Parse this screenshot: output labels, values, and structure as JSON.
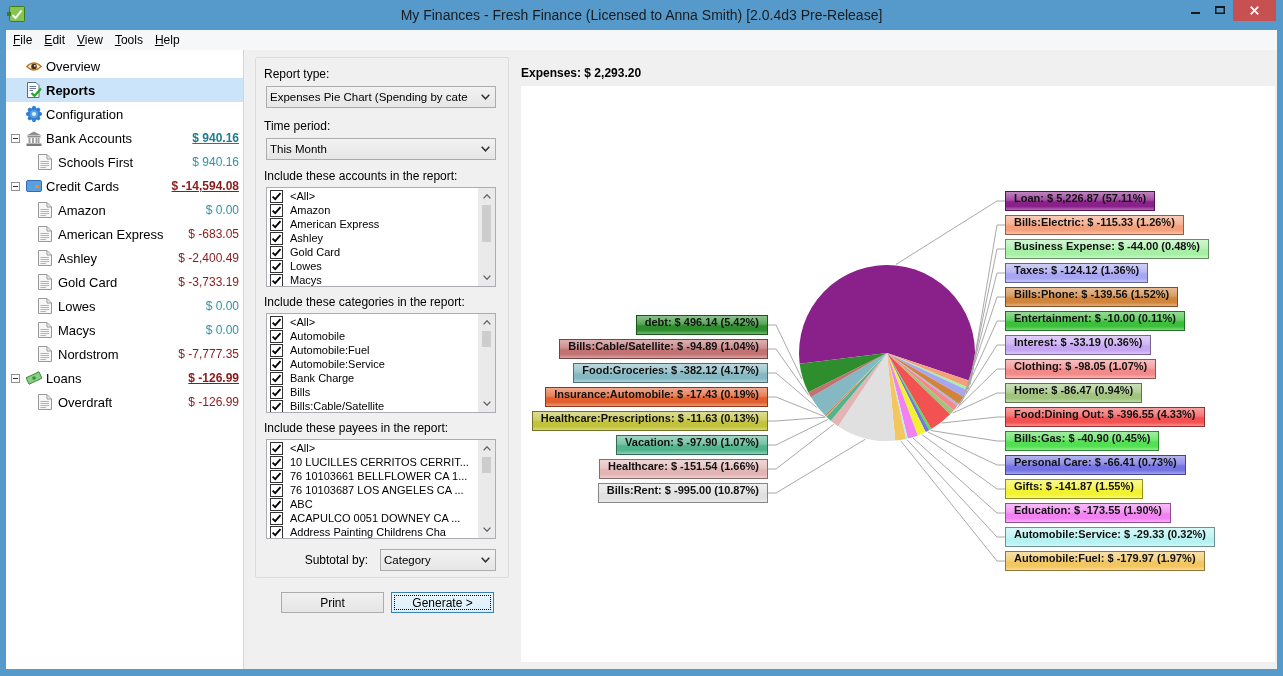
{
  "window": {
    "title": "My Finances - Fresh Finance (Licensed to Anna Smith) [2.0.4d3 Pre-Release]"
  },
  "menu": [
    "File",
    "Edit",
    "View",
    "Tools",
    "Help"
  ],
  "sidebar": {
    "items": [
      {
        "label": "Overview",
        "kind": "overview",
        "selected": false
      },
      {
        "label": "Reports",
        "kind": "reports",
        "selected": true
      },
      {
        "label": "Configuration",
        "kind": "configuration",
        "selected": false
      }
    ],
    "groups": [
      {
        "label": "Bank Accounts",
        "kind": "bank",
        "total": "$ 940.16",
        "negative": false,
        "expanded": true,
        "selected": false,
        "children": [
          {
            "label": "Schools First",
            "balance": "$ 940.16",
            "negative": false,
            "selected": false
          }
        ]
      },
      {
        "label": "Credit Cards",
        "kind": "card",
        "total": "$ -14,594.08",
        "negative": true,
        "expanded": true,
        "selected": false,
        "children": [
          {
            "label": "Amazon",
            "balance": "$ 0.00",
            "negative": false,
            "selected": false
          },
          {
            "label": "American Express",
            "balance": "$ -683.05",
            "negative": true,
            "selected": false
          },
          {
            "label": "Ashley",
            "balance": "$ -2,400.49",
            "negative": true,
            "selected": false
          },
          {
            "label": "Gold Card",
            "balance": "$ -3,733.19",
            "negative": true,
            "selected": false
          },
          {
            "label": "Lowes",
            "balance": "$ 0.00",
            "negative": false,
            "selected": false
          },
          {
            "label": "Macys",
            "balance": "$ 0.00",
            "negative": false,
            "selected": false
          },
          {
            "label": "Nordstrom",
            "balance": "$ -7,777.35",
            "negative": true,
            "selected": false
          }
        ]
      },
      {
        "label": "Loans",
        "kind": "loan",
        "total": "$ -126.99",
        "negative": true,
        "expanded": true,
        "selected": false,
        "children": [
          {
            "label": "Overdraft",
            "balance": "$ -126.99",
            "negative": true,
            "selected": false
          }
        ]
      }
    ]
  },
  "report_options": {
    "report_type": {
      "label": "Report type:",
      "value": "Expenses Pie Chart (Spending by cate"
    },
    "time_period": {
      "label": "Time period:",
      "value": "This Month"
    },
    "lists": [
      {
        "label": "Include these accounts in the report:",
        "items": [
          {
            "label": "<All>",
            "checked": true
          },
          {
            "label": "Amazon",
            "checked": true
          },
          {
            "label": "American Express",
            "checked": true
          },
          {
            "label": "Ashley",
            "checked": true
          },
          {
            "label": "Gold Card",
            "checked": true
          },
          {
            "label": "Lowes",
            "checked": true
          },
          {
            "label": "Macys",
            "checked": true
          }
        ]
      },
      {
        "label": "Include these categories in the report:",
        "items": [
          {
            "label": "<All>",
            "checked": true
          },
          {
            "label": "Automobile",
            "checked": true
          },
          {
            "label": "Automobile:Fuel",
            "checked": true
          },
          {
            "label": "Automobile:Service",
            "checked": true
          },
          {
            "label": "Bank Charge",
            "checked": true
          },
          {
            "label": "Bills",
            "checked": true
          },
          {
            "label": "Bills:Cable/Satellite",
            "checked": true
          }
        ]
      },
      {
        "label": "Include these payees in the report:",
        "items": [
          {
            "label": "<All>",
            "checked": true
          },
          {
            "label": "10 LUCILLES CERRITOS CERRIT...",
            "checked": true
          },
          {
            "label": "76 10103661 BELLFLOWER CA 1...",
            "checked": true
          },
          {
            "label": "76 10103687 LOS ANGELES CA ...",
            "checked": true
          },
          {
            "label": "ABC",
            "checked": true
          },
          {
            "label": "ACAPULCO 0051 DOWNEY CA ...",
            "checked": true
          },
          {
            "label": "Address Painting Childrens Cha",
            "checked": true
          }
        ]
      }
    ],
    "subtotal": {
      "label": "Subtotal by:",
      "value": "Category"
    },
    "buttons": [
      {
        "label": "Print",
        "focused": false
      },
      {
        "label": "Generate >",
        "focused": true
      }
    ]
  },
  "report": {
    "header": "Expenses: $ 2,293.20",
    "chart_data": {
      "type": "pie",
      "categories": [
        "Loan: $ 5,226.87 (57.11%)",
        "Bills:Electric: $ -115.33 (1.26%)",
        "Business Expense: $ -44.00 (0.48%)",
        "Taxes: $ -124.12 (1.36%)",
        "Bills:Phone: $ -139.56 (1.52%)",
        "Entertainment: $ -10.00 (0.11%)",
        "Interest: $ -33.19 (0.36%)",
        "Clothing: $ -98.05 (1.07%)",
        "Home: $ -86.47 (0.94%)",
        "Food:Dining Out: $ -396.55 (4.33%)",
        "Bills:Gas: $ -40.90 (0.45%)",
        "Personal Care: $ -66.41 (0.73%)",
        "Gifts: $ -141.87 (1.55%)",
        "Education: $ -173.55 (1.90%)",
        "Automobile:Service: $ -29.33 (0.32%)",
        "Automobile:Fuel: $ -179.97 (1.97%)",
        "Bills:Rent: $ -995.00 (10.87%)",
        "Healthcare: $ -151.54 (1.66%)",
        "Vacation: $ -97.90 (1.07%)",
        "Healthcare:Prescriptions: $ -11.63 (0.13%)",
        "Insurance:Automobile: $ -17.43 (0.19%)",
        "Food:Groceries: $ -382.12 (4.17%)",
        "Bills:Cable/Satellite: $ -94.89 (1.04%)",
        "debt: $ 496.14 (5.42%)"
      ],
      "values": [
        57.11,
        1.26,
        0.48,
        1.36,
        1.52,
        0.11,
        0.36,
        1.07,
        0.94,
        4.33,
        0.45,
        0.73,
        1.55,
        1.9,
        0.32,
        1.97,
        10.87,
        1.66,
        1.07,
        0.13,
        0.19,
        4.17,
        1.04,
        5.42
      ],
      "colors": [
        "#8a208a",
        "#f4a07c",
        "#a6f0a6",
        "#a6a6f2",
        "#d0843c",
        "#3cc03c",
        "#c6a6f2",
        "#f28a8a",
        "#a0c47e",
        "#f25252",
        "#52e052",
        "#7474e4",
        "#f2f232",
        "#f282f2",
        "#b6f2f2",
        "#f2c660",
        "#e0e0e0",
        "#e2b4b4",
        "#52b48e",
        "#c2c23c",
        "#e2602e",
        "#84b8c2",
        "#c27272",
        "#2e8e2e"
      ]
    }
  }
}
